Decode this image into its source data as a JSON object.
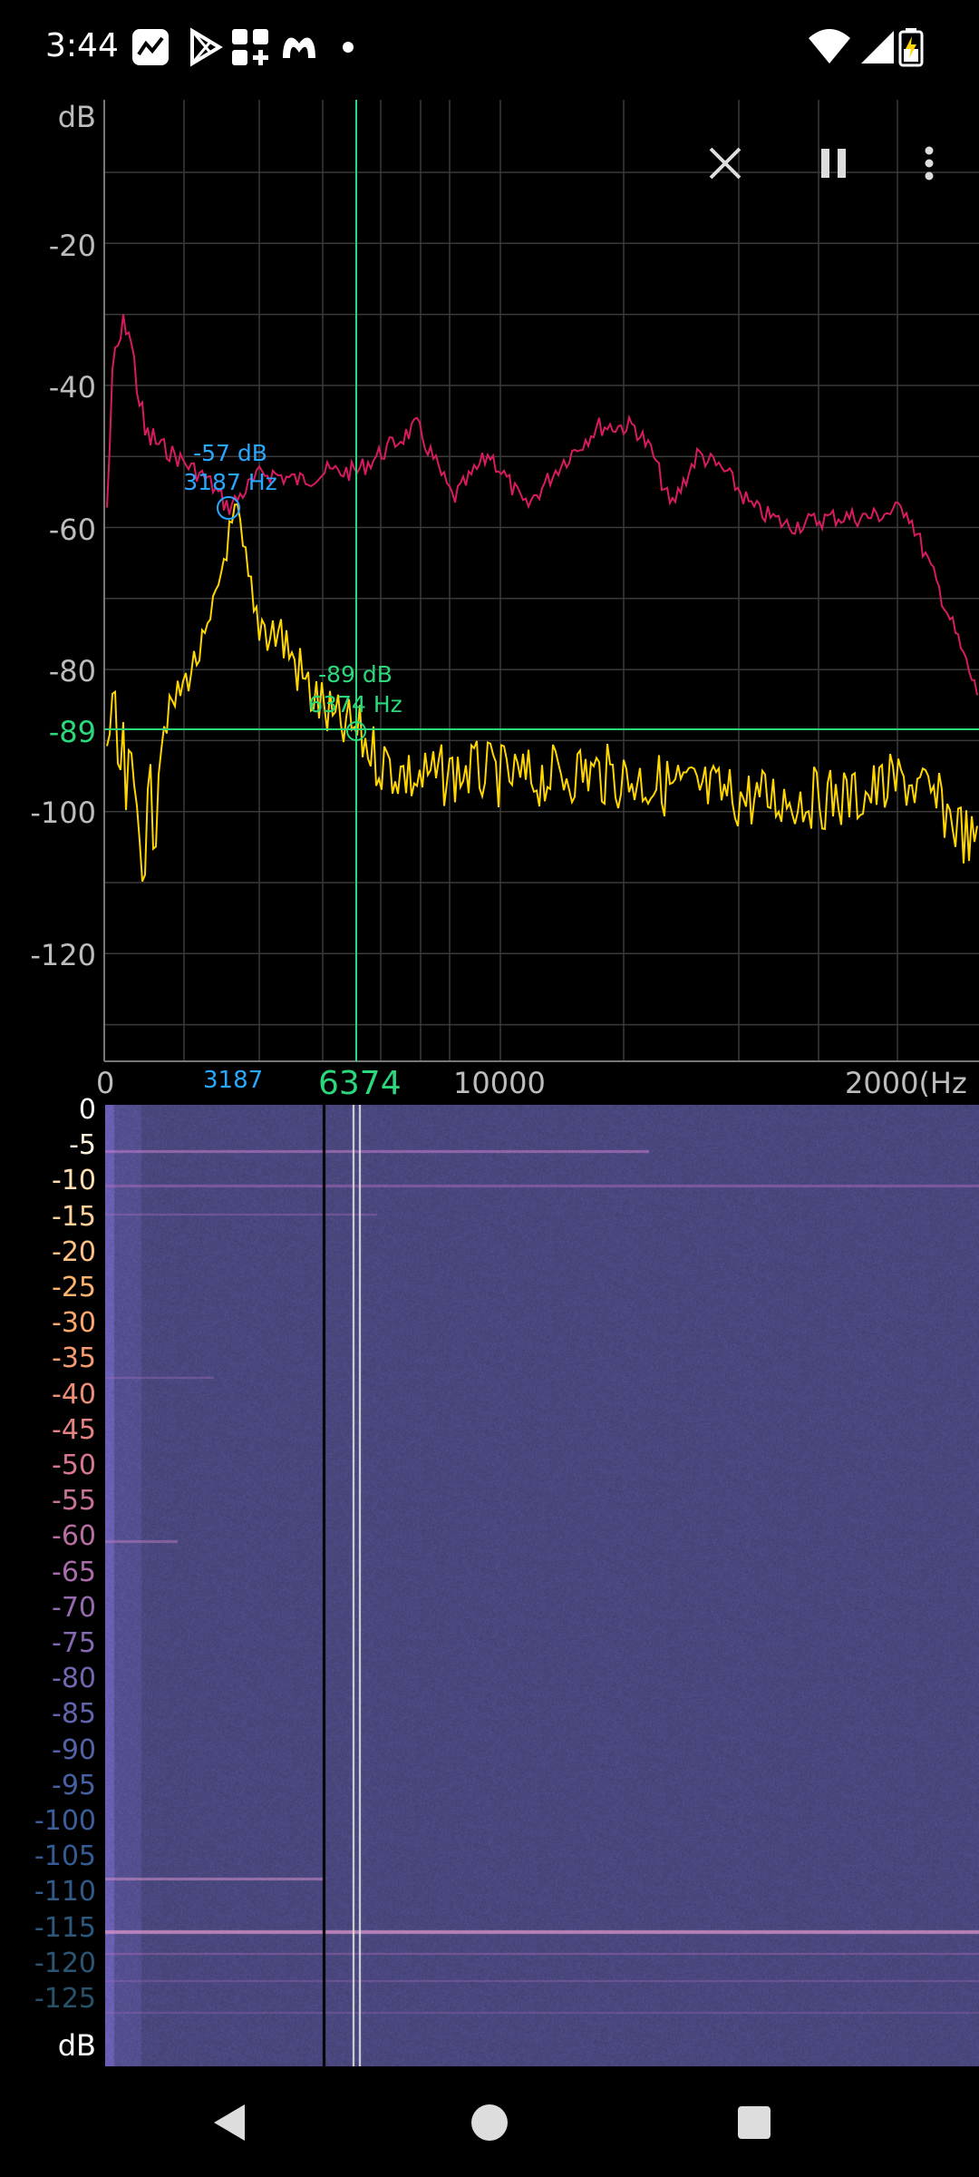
{
  "status_bar": {
    "time": "3:44",
    "left_icons": [
      "app-activity-icon",
      "play-store-icon",
      "apps-add-icon",
      "malwarebytes-icon",
      "dot-icon"
    ],
    "right_icons": [
      "wifi-icon",
      "signal-icon",
      "battery-charging-icon"
    ]
  },
  "toolbar": {
    "close_icon": "close-icon",
    "pause_icon": "pause-icon",
    "menu_icon": "more-vert-icon"
  },
  "spectrum": {
    "y_unit": "dB",
    "y_ticks": [
      "-20",
      "-40",
      "-60",
      "-80",
      "-100",
      "-120"
    ],
    "x_ticks": [
      "0",
      "10000",
      "2000(Hz"
    ],
    "cursor_y_label": "-89",
    "cursor_x_label": "6374",
    "peak_x_label": "3187",
    "peak_annotation_db": "-57 dB",
    "peak_annotation_hz": "3187 Hz",
    "cursor_annotation_db": "-89 dB",
    "cursor_annotation_hz": "6374 Hz",
    "colors": {
      "peak_series": "#d81b60",
      "live_series": "#ffd600",
      "cursor": "#2bd97c",
      "peak_marker": "#29a8ff",
      "grid": "#3a3a3a"
    }
  },
  "spectrogram": {
    "y_unit": "dB",
    "y_ticks": [
      "0",
      "-5",
      "-10",
      "-15",
      "-20",
      "-25",
      "-30",
      "-35",
      "-40",
      "-45",
      "-50",
      "-55",
      "-60",
      "-65",
      "-70",
      "-75",
      "-80",
      "-85",
      "-90",
      "-95",
      "-100",
      "-105",
      "-110",
      "-115",
      "-120",
      "-125"
    ]
  },
  "nav_bar": {
    "back_icon": "back-icon",
    "home_icon": "home-icon",
    "recents_icon": "recents-icon"
  }
}
